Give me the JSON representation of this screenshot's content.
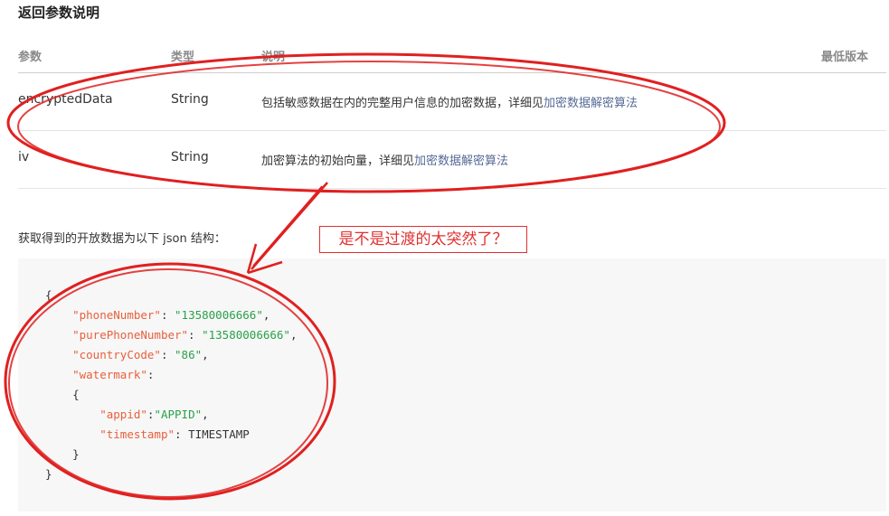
{
  "page": {
    "title": "返回参数说明"
  },
  "table": {
    "headers": {
      "param": "参数",
      "type": "类型",
      "desc": "说明",
      "version": "最低版本"
    },
    "rows": [
      {
        "param": "encryptedData",
        "type": "String",
        "desc": "包括敏感数据在内的完整用户信息的加密数据，详细见",
        "link": "加密数据解密算法"
      },
      {
        "param": "iv",
        "type": "String",
        "desc": "加密算法的初始向量，详细见",
        "link": "加密数据解密算法"
      }
    ]
  },
  "intro": {
    "text": "获取得到的开放数据为以下 json 结构："
  },
  "annotation": {
    "text": "是不是过渡的太突然了？",
    "color": "#e03030"
  },
  "code": {
    "open_brace": "{",
    "phone_key": "\"phoneNumber\"",
    "phone_val": "\"13580006666\"",
    "pure_key": "\"purePhoneNumber\"",
    "pure_val": "\"13580006666\"",
    "country_key": "\"countryCode\"",
    "country_val": "\"86\"",
    "watermark_key": "\"watermark\"",
    "inner_open": "{",
    "appid_key": "\"appid\"",
    "appid_val": "\"APPID\"",
    "ts_key": "\"timestamp\"",
    "ts_val": "TIMESTAMP",
    "inner_close": "}",
    "close_brace": "}"
  },
  "colors": {
    "link": "#576b95",
    "json_key": "#e8603c",
    "json_string": "#2aa14a",
    "code_bg": "#f7f7f7"
  }
}
